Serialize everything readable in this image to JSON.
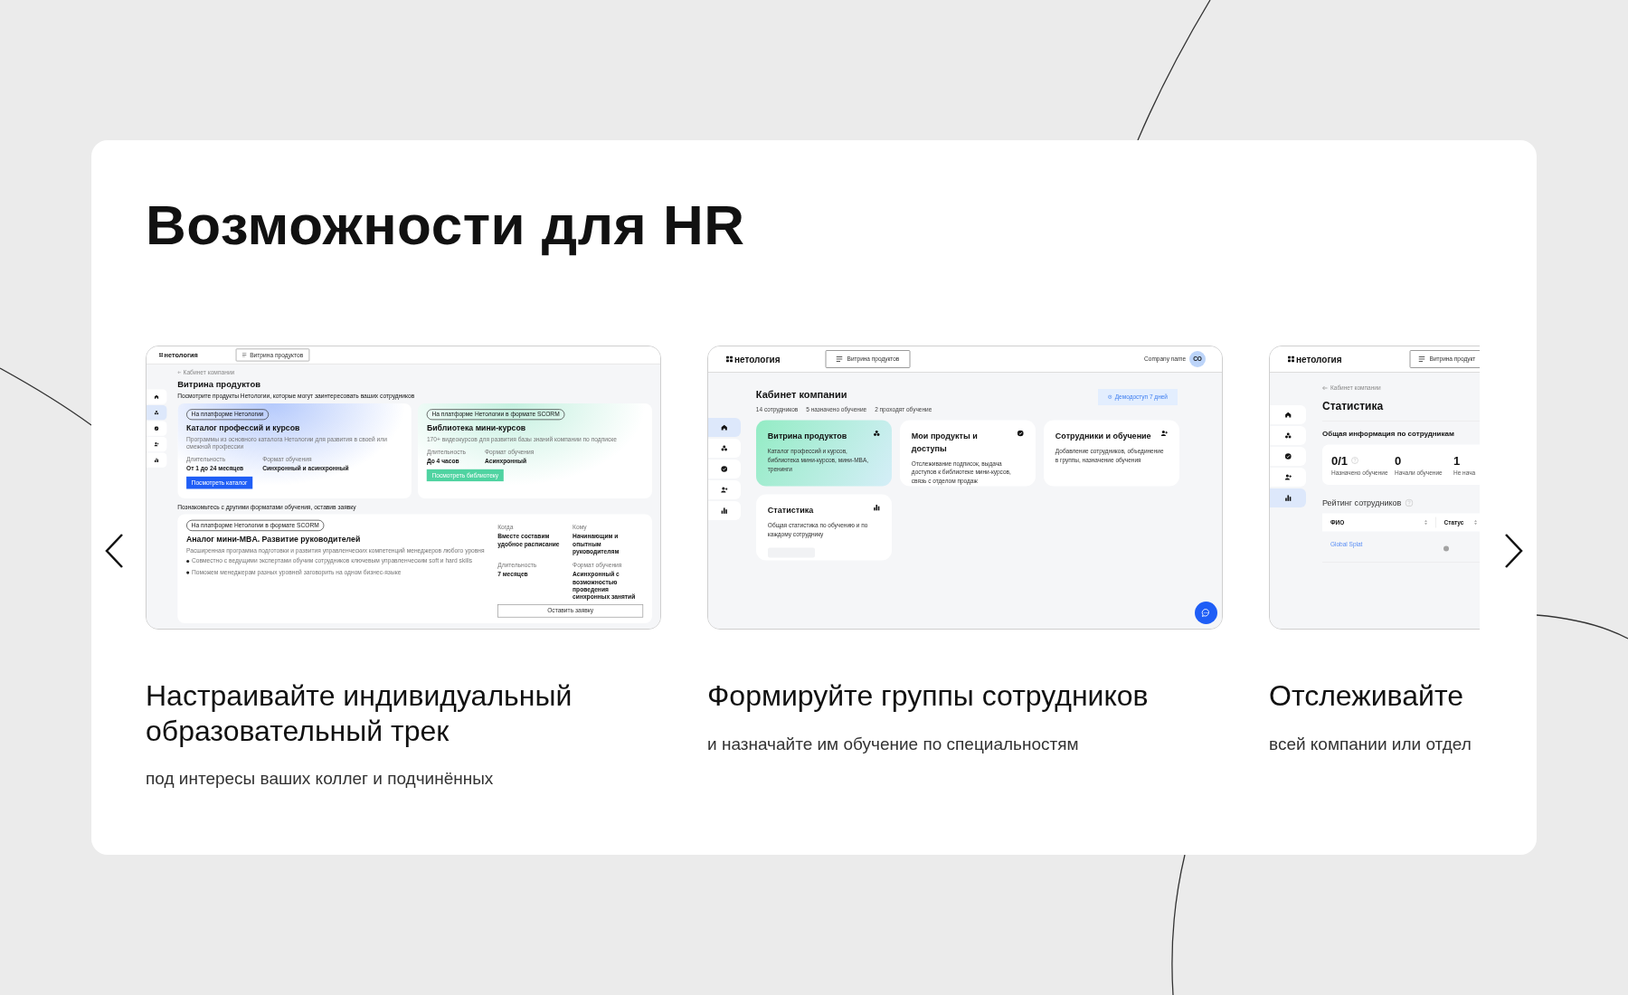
{
  "title": "Возможности для HR",
  "slides": [
    {
      "kind": "showcase",
      "caption": "Настраивайте индивидуальный образовательный трек",
      "subcaption": "под интересы ваших коллег и подчинённых",
      "app": {
        "logo": "нетология",
        "nav_button": "Витрина продуктов",
        "sidebar": [
          {
            "selected": false
          },
          {
            "selected": true
          },
          {
            "selected": false
          },
          {
            "selected": false
          },
          {
            "selected": false
          }
        ],
        "breadcrumb": "Кабинет компании",
        "heading": "Витрина продуктов",
        "intro": "Посмотрите продукты Нетологии, которые могут заинтересовать ваших сотрудников",
        "products": [
          {
            "color": "#1f5ef6",
            "tag": "На платформе Нетологии",
            "title": "Каталог профессий и курсов",
            "description": "Программы из основного каталога Нетологии для развития в своей или смежной профессии",
            "facts": [
              {
                "label": "Длительность",
                "value": "От 1 до 24 месяцев"
              },
              {
                "label": "Формат обучения",
                "value": "Синхронный и асинхронный"
              }
            ],
            "button": "Посмотреть каталог"
          },
          {
            "color": "#4fd3a1",
            "tag": "На платформе Нетологии в формате SCORM",
            "title": "Библиотека мини-курсов",
            "description": "170+ видеокурсов для развития базы знаний компании по подписке",
            "facts": [
              {
                "label": "Длительность",
                "value": "До 4 часов"
              },
              {
                "label": "Формат обучения",
                "value": "Асинхронный"
              }
            ],
            "button": "Посмотреть библиотеку"
          }
        ],
        "section_label": "Познакомьтесь с другими форматами обучения, оставив заявку",
        "offer": {
          "tag": "На платформе Нетологии в формате SCORM",
          "title": "Аналог мини-MBA. Развитие руководителей",
          "description": "Расширенная программа подготовки и развития управленческих компетенций менеджеров любого уровня",
          "bullets": [
            "Совместно с ведущими экспертами обучим сотрудников ключевым управленческим soft и hard skills",
            "Поможем менеджерам разных уровней заговорить на одном бизнес-языке"
          ],
          "facts": [
            {
              "label": "Когда",
              "value": "Вместе составим удобное расписание"
            },
            {
              "label": "Кому",
              "value": "Начинающим и опытным руководителям"
            },
            {
              "label": "Длительность",
              "value": "7 месяцев"
            },
            {
              "label": "Формат обучения",
              "value": "Асинхронный с возможностью проведения синхронных занятий"
            }
          ],
          "button": "Оставить заявку"
        }
      }
    },
    {
      "kind": "dashboard",
      "caption": "Формируйте группы сотрудников",
      "subcaption": "и назначайте им обучение по специальностям",
      "app": {
        "logo": "нетология",
        "nav_button": "Витрина продуктов",
        "company": "Company name",
        "avatar": "CO",
        "sidebar": [
          {
            "selected": true
          },
          {
            "selected": false
          },
          {
            "selected": false
          },
          {
            "selected": false
          },
          {
            "selected": false
          }
        ],
        "heading": "Кабинет компании",
        "stats": [
          "14 сотрудников",
          "5 назначено обучение",
          "2 проходят обучение"
        ],
        "demo_badge": "Демодоступ 7 дней",
        "tiles": [
          {
            "title": "Витрина продуктов",
            "description": "Каталог профессий и курсов, библиотека мини-курсов, мини-MBA, тренинги",
            "highlighted": true,
            "loading": false
          },
          {
            "title": "Мои продукты и доступы",
            "description": "Отслеживание подписок, выдача доступов к библиотеке мини-курсов, связь с отделом продаж",
            "highlighted": false,
            "loading": false
          },
          {
            "title": "Сотрудники и обучение",
            "description": "Добавление сотрудников, объединение в группы, назначение обучения",
            "highlighted": false,
            "loading": false
          },
          {
            "title": "Статистика",
            "description": "Общая статистика по обучению и по каждому сотруднику",
            "highlighted": false,
            "loading": true
          }
        ]
      }
    },
    {
      "kind": "statistics",
      "caption": "Отслеживайте",
      "subcaption": "всей компании или отдел",
      "app": {
        "logo": "нетология",
        "nav_button": "Витрина продукт",
        "sidebar": [
          {
            "selected": false
          },
          {
            "selected": false
          },
          {
            "selected": false
          },
          {
            "selected": false
          },
          {
            "selected": true
          }
        ],
        "breadcrumb": "Кабинет компании",
        "heading": "Статистика",
        "summary_title": "Общая информация по сотрудникам",
        "metrics": [
          {
            "value": "0/1",
            "label": "Назначено обучение",
            "hint": true
          },
          {
            "value": "0",
            "label": "Начали обучение",
            "hint": false
          },
          {
            "value": "1",
            "label": "Не нача",
            "hint": false
          }
        ],
        "rating_title": "Рейтинг сотрудников",
        "columns": [
          "ФИО",
          "Статус"
        ],
        "rows": [
          {
            "name": "Global Splat",
            "color": "#a3a3a3"
          }
        ]
      }
    }
  ]
}
